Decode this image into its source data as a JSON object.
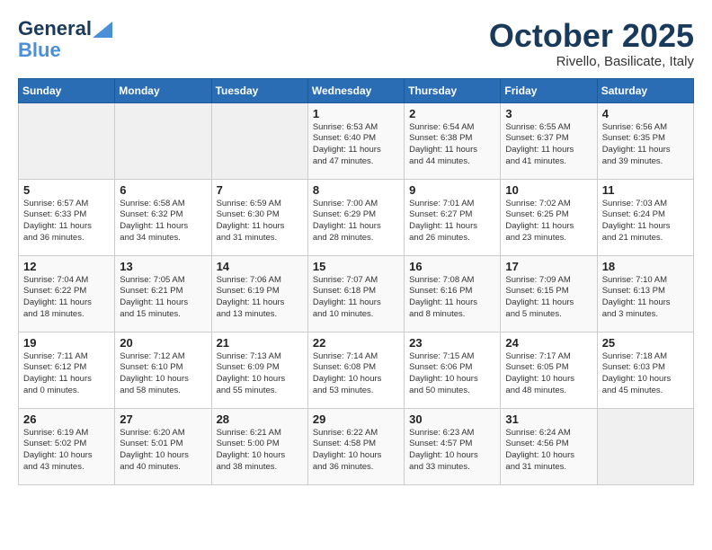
{
  "logo": {
    "line1": "General",
    "line2": "Blue"
  },
  "title": "October 2025",
  "subtitle": "Rivello, Basilicate, Italy",
  "days_of_week": [
    "Sunday",
    "Monday",
    "Tuesday",
    "Wednesday",
    "Thursday",
    "Friday",
    "Saturday"
  ],
  "weeks": [
    [
      {
        "day": "",
        "info": ""
      },
      {
        "day": "",
        "info": ""
      },
      {
        "day": "",
        "info": ""
      },
      {
        "day": "1",
        "info": "Sunrise: 6:53 AM\nSunset: 6:40 PM\nDaylight: 11 hours\nand 47 minutes."
      },
      {
        "day": "2",
        "info": "Sunrise: 6:54 AM\nSunset: 6:38 PM\nDaylight: 11 hours\nand 44 minutes."
      },
      {
        "day": "3",
        "info": "Sunrise: 6:55 AM\nSunset: 6:37 PM\nDaylight: 11 hours\nand 41 minutes."
      },
      {
        "day": "4",
        "info": "Sunrise: 6:56 AM\nSunset: 6:35 PM\nDaylight: 11 hours\nand 39 minutes."
      }
    ],
    [
      {
        "day": "5",
        "info": "Sunrise: 6:57 AM\nSunset: 6:33 PM\nDaylight: 11 hours\nand 36 minutes."
      },
      {
        "day": "6",
        "info": "Sunrise: 6:58 AM\nSunset: 6:32 PM\nDaylight: 11 hours\nand 34 minutes."
      },
      {
        "day": "7",
        "info": "Sunrise: 6:59 AM\nSunset: 6:30 PM\nDaylight: 11 hours\nand 31 minutes."
      },
      {
        "day": "8",
        "info": "Sunrise: 7:00 AM\nSunset: 6:29 PM\nDaylight: 11 hours\nand 28 minutes."
      },
      {
        "day": "9",
        "info": "Sunrise: 7:01 AM\nSunset: 6:27 PM\nDaylight: 11 hours\nand 26 minutes."
      },
      {
        "day": "10",
        "info": "Sunrise: 7:02 AM\nSunset: 6:25 PM\nDaylight: 11 hours\nand 23 minutes."
      },
      {
        "day": "11",
        "info": "Sunrise: 7:03 AM\nSunset: 6:24 PM\nDaylight: 11 hours\nand 21 minutes."
      }
    ],
    [
      {
        "day": "12",
        "info": "Sunrise: 7:04 AM\nSunset: 6:22 PM\nDaylight: 11 hours\nand 18 minutes."
      },
      {
        "day": "13",
        "info": "Sunrise: 7:05 AM\nSunset: 6:21 PM\nDaylight: 11 hours\nand 15 minutes."
      },
      {
        "day": "14",
        "info": "Sunrise: 7:06 AM\nSunset: 6:19 PM\nDaylight: 11 hours\nand 13 minutes."
      },
      {
        "day": "15",
        "info": "Sunrise: 7:07 AM\nSunset: 6:18 PM\nDaylight: 11 hours\nand 10 minutes."
      },
      {
        "day": "16",
        "info": "Sunrise: 7:08 AM\nSunset: 6:16 PM\nDaylight: 11 hours\nand 8 minutes."
      },
      {
        "day": "17",
        "info": "Sunrise: 7:09 AM\nSunset: 6:15 PM\nDaylight: 11 hours\nand 5 minutes."
      },
      {
        "day": "18",
        "info": "Sunrise: 7:10 AM\nSunset: 6:13 PM\nDaylight: 11 hours\nand 3 minutes."
      }
    ],
    [
      {
        "day": "19",
        "info": "Sunrise: 7:11 AM\nSunset: 6:12 PM\nDaylight: 11 hours\nand 0 minutes."
      },
      {
        "day": "20",
        "info": "Sunrise: 7:12 AM\nSunset: 6:10 PM\nDaylight: 10 hours\nand 58 minutes."
      },
      {
        "day": "21",
        "info": "Sunrise: 7:13 AM\nSunset: 6:09 PM\nDaylight: 10 hours\nand 55 minutes."
      },
      {
        "day": "22",
        "info": "Sunrise: 7:14 AM\nSunset: 6:08 PM\nDaylight: 10 hours\nand 53 minutes."
      },
      {
        "day": "23",
        "info": "Sunrise: 7:15 AM\nSunset: 6:06 PM\nDaylight: 10 hours\nand 50 minutes."
      },
      {
        "day": "24",
        "info": "Sunrise: 7:17 AM\nSunset: 6:05 PM\nDaylight: 10 hours\nand 48 minutes."
      },
      {
        "day": "25",
        "info": "Sunrise: 7:18 AM\nSunset: 6:03 PM\nDaylight: 10 hours\nand 45 minutes."
      }
    ],
    [
      {
        "day": "26",
        "info": "Sunrise: 6:19 AM\nSunset: 5:02 PM\nDaylight: 10 hours\nand 43 minutes."
      },
      {
        "day": "27",
        "info": "Sunrise: 6:20 AM\nSunset: 5:01 PM\nDaylight: 10 hours\nand 40 minutes."
      },
      {
        "day": "28",
        "info": "Sunrise: 6:21 AM\nSunset: 5:00 PM\nDaylight: 10 hours\nand 38 minutes."
      },
      {
        "day": "29",
        "info": "Sunrise: 6:22 AM\nSunset: 4:58 PM\nDaylight: 10 hours\nand 36 minutes."
      },
      {
        "day": "30",
        "info": "Sunrise: 6:23 AM\nSunset: 4:57 PM\nDaylight: 10 hours\nand 33 minutes."
      },
      {
        "day": "31",
        "info": "Sunrise: 6:24 AM\nSunset: 4:56 PM\nDaylight: 10 hours\nand 31 minutes."
      },
      {
        "day": "",
        "info": ""
      }
    ]
  ]
}
